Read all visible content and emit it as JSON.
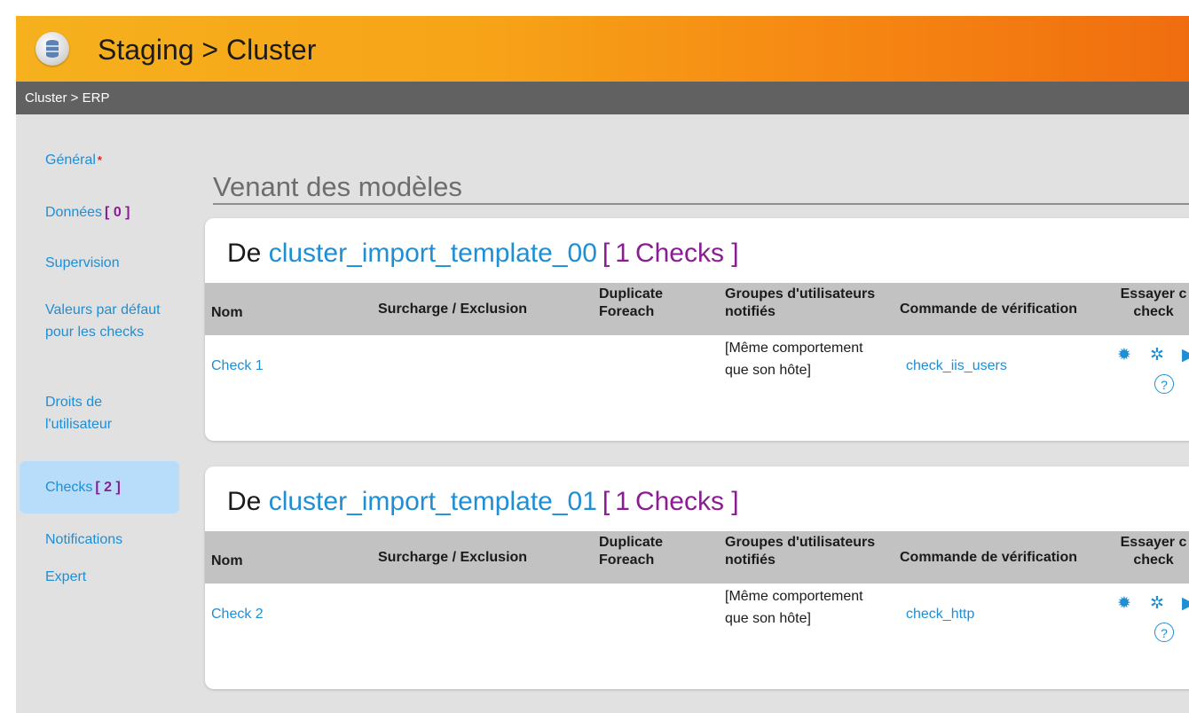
{
  "header": {
    "title": "Staging > Cluster"
  },
  "breadcrumb": "Cluster > ERP",
  "sidebar": {
    "items": [
      {
        "label": "Général",
        "required_mark": "*"
      },
      {
        "label": "Données",
        "count": "[ 0 ]"
      },
      {
        "label": "Supervision"
      },
      {
        "label": "Valeurs par défaut pour les checks"
      },
      {
        "label": "Droits de l'utilisateur"
      },
      {
        "label": "Checks",
        "count": "[ 2 ]",
        "active": true
      },
      {
        "label": "Notifications"
      },
      {
        "label": "Expert"
      }
    ]
  },
  "main": {
    "section_title": "Venant des modèles",
    "columns": [
      "Nom",
      "Surcharge / Exclusion",
      "Duplicate Foreach",
      "Groupes d'utilisateurs notifiés",
      "Commande de vérification",
      "Essayer c check"
    ],
    "groups": [
      {
        "prefix": "De",
        "template": "cluster_import_template_00",
        "count_open": "[",
        "count": "1",
        "count_label": "Checks ]",
        "rows": [
          {
            "name": "Check 1",
            "override": "",
            "duplicate": "",
            "groups": "[Même comportement que son hôte]",
            "command": "check_iis_users"
          }
        ]
      },
      {
        "prefix": "De",
        "template": "cluster_import_template_01",
        "count_open": "[",
        "count": "1",
        "count_label": "Checks ]",
        "rows": [
          {
            "name": "Check 2",
            "override": "",
            "duplicate": "",
            "groups": "[Même comportement que son hôte]",
            "command": "check_http"
          }
        ]
      }
    ]
  },
  "icons": {
    "settings": "gear-icon",
    "refresh": "refresh-gear-icon",
    "run": "play-icon",
    "help": "help-icon"
  },
  "colors": {
    "accent_orange": "#f7a318",
    "link_blue": "#1f8ed3",
    "count_purple": "#8a1d91",
    "active_nav": "#b8ddfa"
  }
}
